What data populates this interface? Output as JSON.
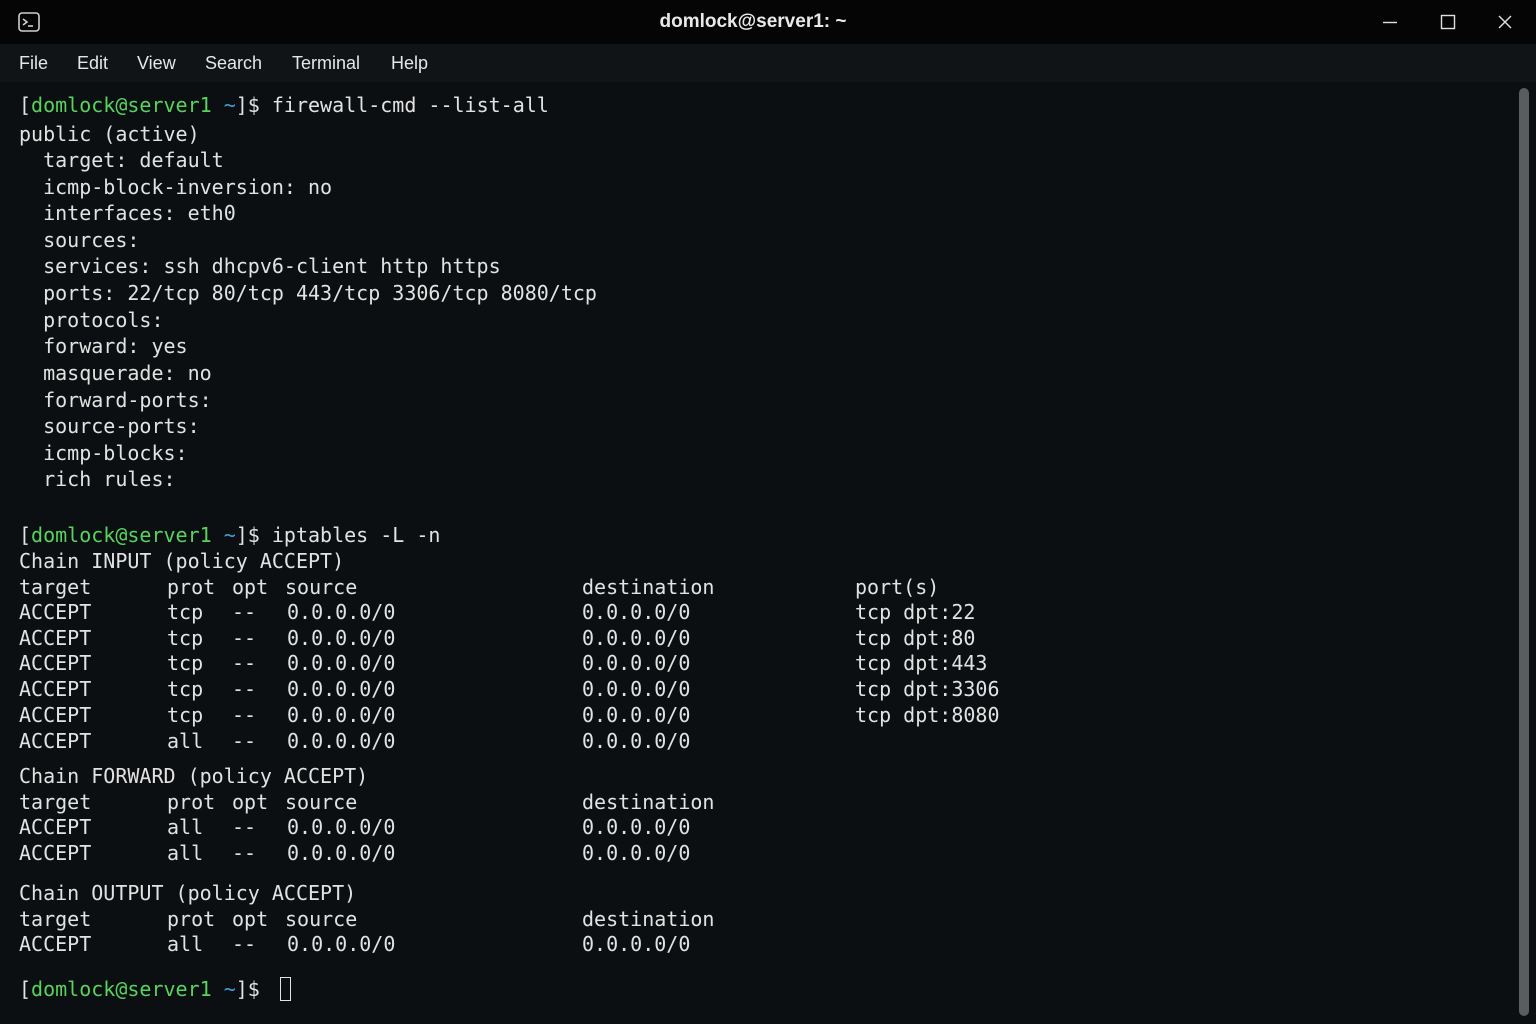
{
  "window": {
    "title": "domlock@server1: ~",
    "icons": {
      "app": "terminal-icon",
      "minimize": "minimize-icon",
      "maximize": "maximize-icon",
      "close": "close-icon"
    }
  },
  "menu": [
    "File",
    "Edit",
    "View",
    "Search",
    "Terminal",
    "Help"
  ],
  "colors": {
    "prompt_user": "#57d35e",
    "prompt_tilde": "#3fa0d8",
    "text": "#e2e2e2",
    "background": "#0c0f11"
  },
  "terminal": {
    "prompt": {
      "open": "[",
      "user": "domlock@server1",
      "tilde": "~",
      "close": "]$ "
    },
    "cmd1": "firewall-cmd --list-all",
    "zone_lines": [
      "public (active)",
      "  target: default",
      "  icmp-block-inversion: no",
      "  interfaces: eth0",
      "  sources:",
      "  services: ssh dhcpv6-client http https",
      "  ports: 22/tcp 80/tcp 443/tcp 3306/tcp 8080/tcp",
      "  protocols:",
      "  forward: yes",
      "  masquerade: no",
      "  forward-ports:",
      "  source-ports:",
      "  icmp-blocks:",
      "  rich rules:"
    ],
    "cmd2": "iptables -L -n",
    "header": {
      "target": "target",
      "prot": "prot",
      "opt": "opt",
      "source": "source",
      "destination": "destination",
      "ports": "port(s)"
    },
    "chains": [
      {
        "title": "Chain INPUT (policy ACCEPT)",
        "show_ports": true,
        "rows": [
          [
            "ACCEPT",
            "tcp",
            "--",
            "0.0.0.0/0",
            "0.0.0.0/0",
            "tcp dpt:22"
          ],
          [
            "ACCEPT",
            "tcp",
            "--",
            "0.0.0.0/0",
            "0.0.0.0/0",
            "tcp dpt:80"
          ],
          [
            "ACCEPT",
            "tcp",
            "--",
            "0.0.0.0/0",
            "0.0.0.0/0",
            "tcp dpt:443"
          ],
          [
            "ACCEPT",
            "tcp",
            "--",
            "0.0.0.0/0",
            "0.0.0.0/0",
            "tcp dpt:3306"
          ],
          [
            "ACCEPT",
            "tcp",
            "--",
            "0.0.0.0/0",
            "0.0.0.0/0",
            "tcp dpt:8080"
          ],
          [
            "ACCEPT",
            "all",
            "--",
            "0.0.0.0/0",
            "0.0.0.0/0",
            ""
          ]
        ]
      },
      {
        "title": "Chain FORWARD (policy ACCEPT)",
        "show_ports": false,
        "rows": [
          [
            "ACCEPT",
            "all",
            "--",
            "0.0.0.0/0",
            "0.0.0.0/0",
            ""
          ],
          [
            "ACCEPT",
            "all",
            "--",
            "0.0.0.0/0",
            "0.0.0.0/0",
            ""
          ]
        ]
      },
      {
        "title": "Chain OUTPUT (policy ACCEPT)",
        "show_ports": false,
        "rows": [
          [
            "ACCEPT",
            "all",
            "--",
            "0.0.0.0/0",
            "0.0.0.0/0",
            ""
          ]
        ]
      }
    ]
  }
}
